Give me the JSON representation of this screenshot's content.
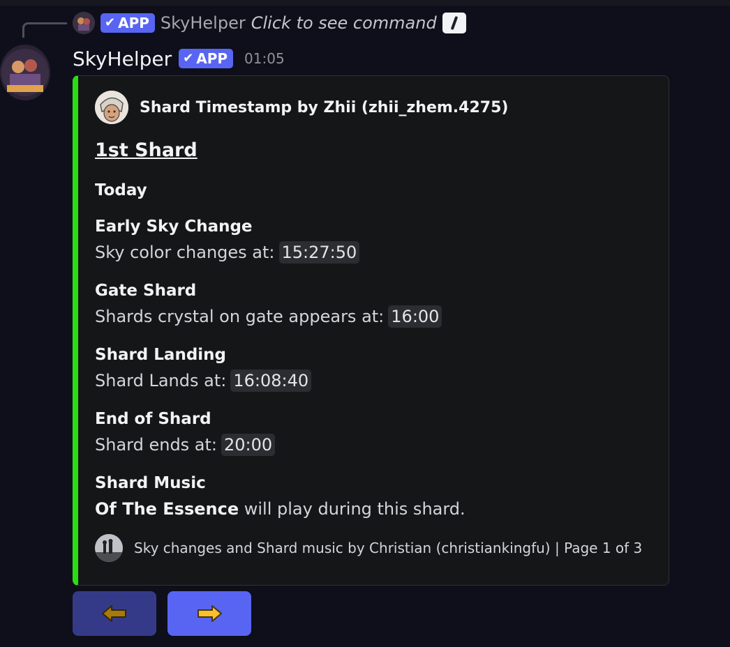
{
  "reply": {
    "badge": "APP",
    "name": "SkyHelper",
    "command_text": "Click to see command"
  },
  "message": {
    "author": "SkyHelper",
    "badge": "APP",
    "time": "01:05"
  },
  "embed": {
    "accent_color": "#2bdc12",
    "author_name": "Shard Timestamp by Zhii (zhii_zhem.4275)",
    "title": "1st Shard",
    "day": "Today",
    "fields": [
      {
        "name": "Early Sky Change",
        "prefix": "Sky color changes at:",
        "value": "15:27:50"
      },
      {
        "name": "Gate Shard",
        "prefix": "Shards crystal on gate appears at:",
        "value": "16:00"
      },
      {
        "name": "Shard Landing",
        "prefix": "Shard Lands at:",
        "value": "16:08:40"
      },
      {
        "name": "End of Shard",
        "prefix": "Shard ends at:",
        "value": "20:00"
      }
    ],
    "music": {
      "name": "Shard Music",
      "song": "Of The Essence",
      "suffix": " will play during this shard."
    },
    "footer": "Sky changes and Shard music by Christian (christiankingfu) | Page 1 of 3"
  },
  "buttons": {
    "prev_icon": "arrow-left-icon",
    "next_icon": "arrow-right-icon",
    "next_color": "#5865f2",
    "prev_color": "#3a3f94"
  }
}
